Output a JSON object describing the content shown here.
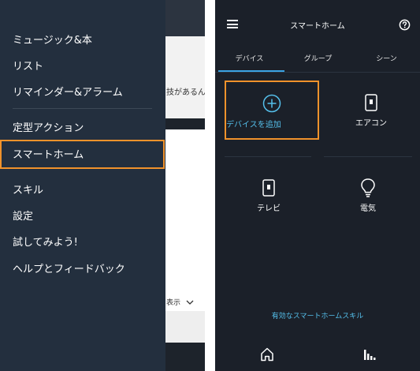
{
  "drawer": {
    "items": [
      {
        "label": "ミュージック&本"
      },
      {
        "label": "リスト"
      },
      {
        "label": "リマインダー&アラーム"
      },
      {
        "label": "定型アクション"
      },
      {
        "label": "スマートホーム"
      },
      {
        "label": "スキル"
      },
      {
        "label": "設定"
      },
      {
        "label": "試してみよう!"
      },
      {
        "label": "ヘルプとフィードバック"
      }
    ],
    "background_fragment_1": "技があるん",
    "background_fragment_2": "表示"
  },
  "smarthome": {
    "title": "スマートホーム",
    "tabs": [
      {
        "label": "デバイス"
      },
      {
        "label": "グループ"
      },
      {
        "label": "シーン"
      }
    ],
    "devices": [
      {
        "label": "デバイスを追加",
        "icon": "add-circle-icon"
      },
      {
        "label": "エアコン",
        "icon": "device-icon"
      },
      {
        "label": "テレビ",
        "icon": "device-icon"
      },
      {
        "label": "電気",
        "icon": "light-bulb-icon"
      }
    ],
    "skills_link": "有効なスマートホームスキル"
  },
  "colors": {
    "drawer_bg": "#232f3e",
    "app_bg": "#1b2029",
    "highlight": "#f0922b",
    "accent": "#3aa3e3",
    "link": "#55c0ec"
  }
}
